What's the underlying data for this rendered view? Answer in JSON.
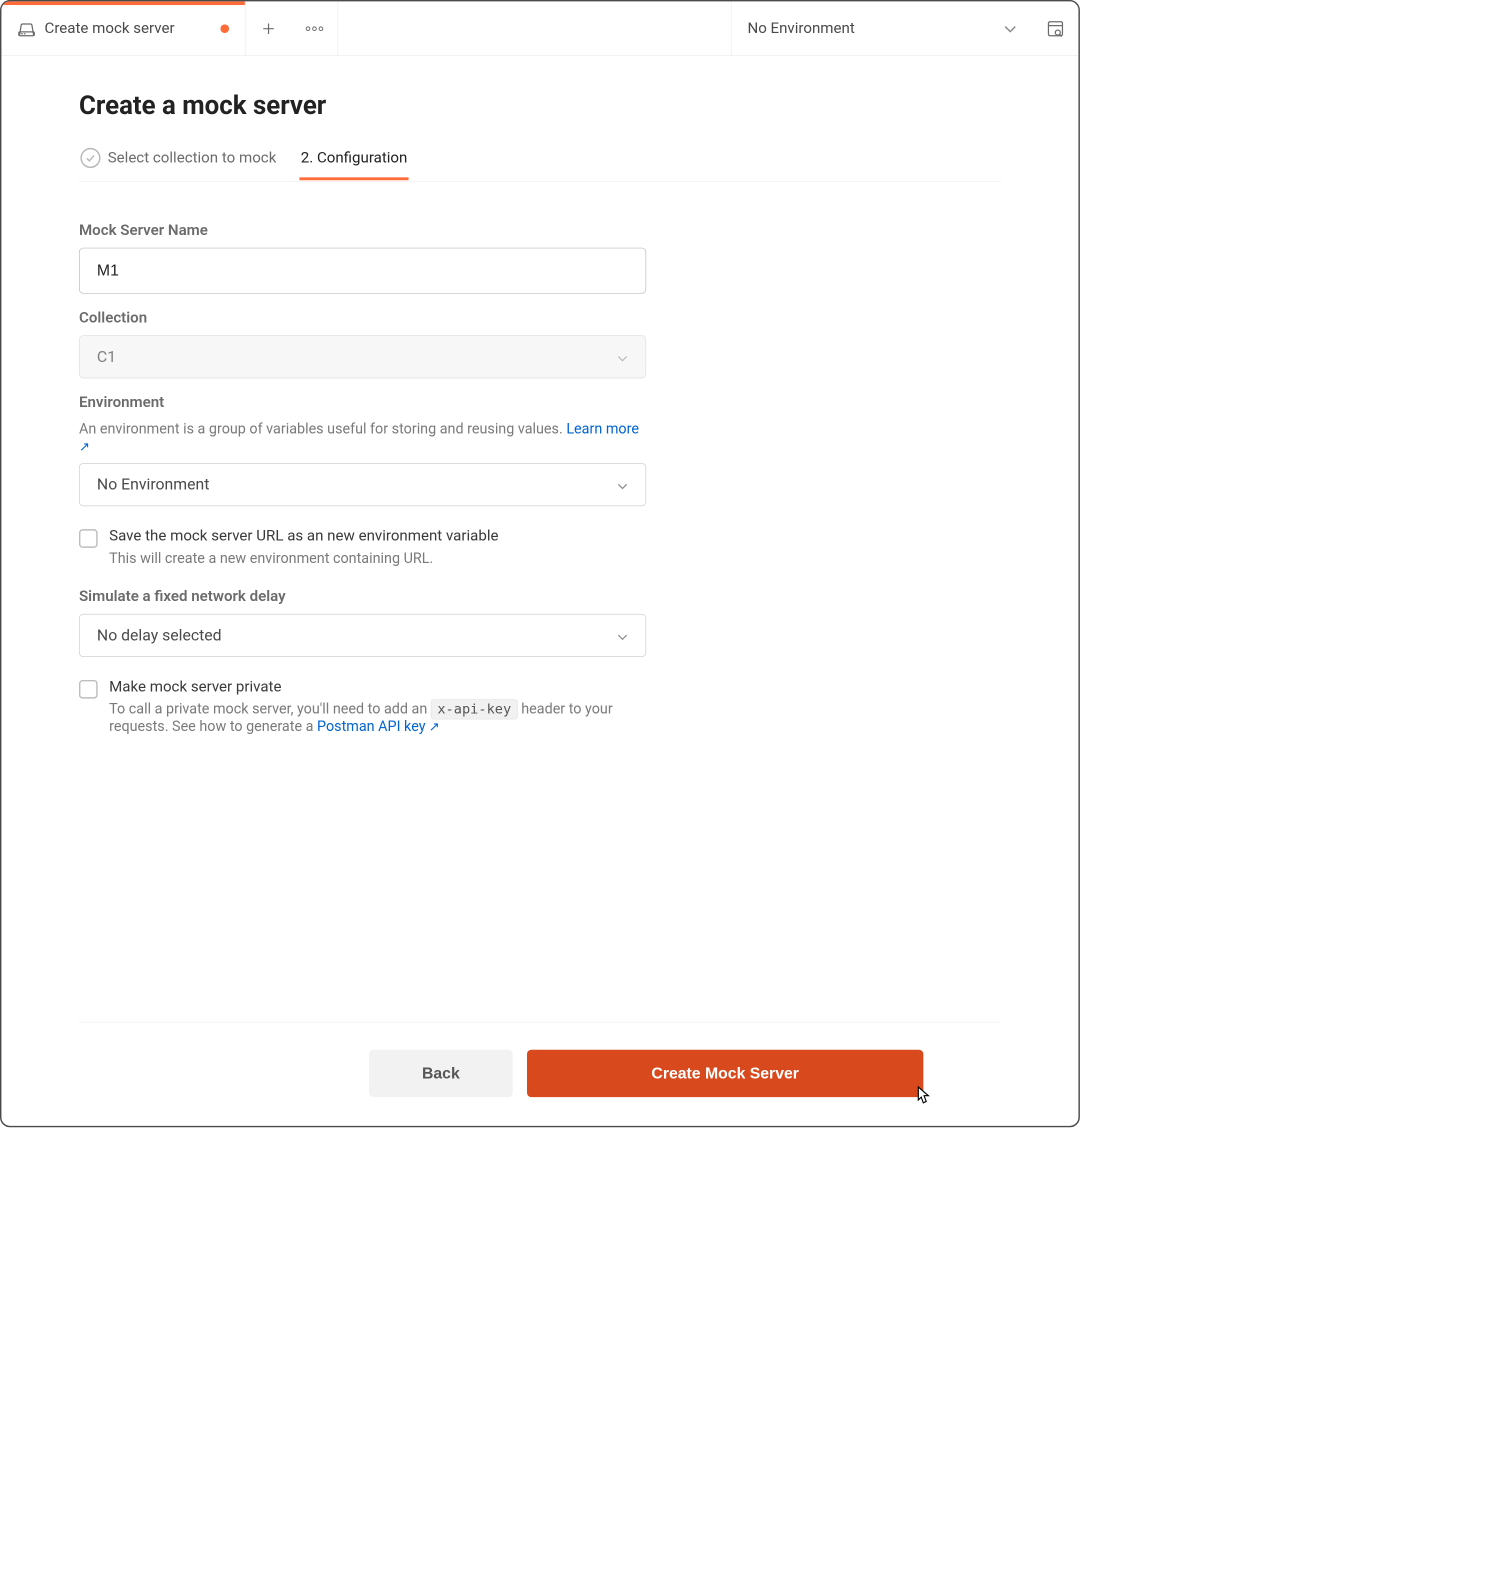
{
  "tabstrip": {
    "active_tab_label": "Create mock server",
    "env_picker_label": "No Environment"
  },
  "page": {
    "title": "Create a mock server",
    "steps": {
      "step1": "Select collection to mock",
      "step2": "2. Configuration"
    }
  },
  "form": {
    "name_label": "Mock Server Name",
    "name_value": "M1",
    "collection_label": "Collection",
    "collection_value": "C1",
    "env_label": "Environment",
    "env_help": "An environment is a group of variables useful for storing and reusing values.",
    "env_learn_more": "Learn more",
    "env_value": "No Environment",
    "save_url_label": "Save the mock server URL as an new environment variable",
    "save_url_desc": "This will create a new environment containing URL.",
    "delay_label": "Simulate a fixed network delay",
    "delay_value": "No delay selected",
    "private_label": "Make mock server private",
    "private_desc_pre": "To call a private mock server, you'll need to add an ",
    "private_code": "x-api-key",
    "private_desc_mid": " header to your requests. See how to generate a ",
    "private_link": "Postman API key"
  },
  "footer": {
    "back": "Back",
    "create": "Create Mock Server"
  }
}
